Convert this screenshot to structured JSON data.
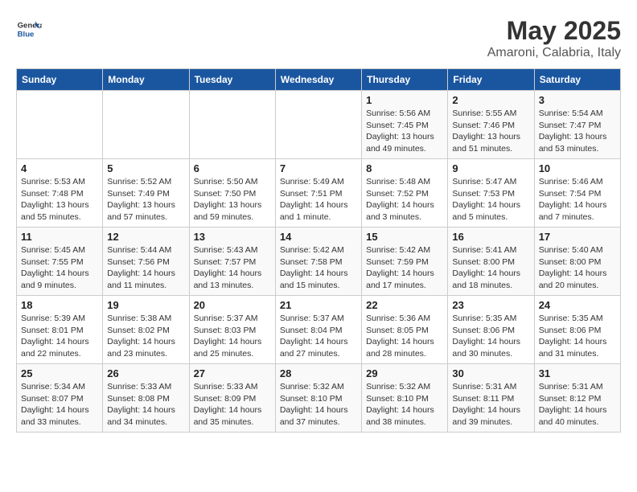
{
  "header": {
    "logo_general": "General",
    "logo_blue": "Blue",
    "title": "May 2025",
    "subtitle": "Amaroni, Calabria, Italy"
  },
  "calendar": {
    "days_of_week": [
      "Sunday",
      "Monday",
      "Tuesday",
      "Wednesday",
      "Thursday",
      "Friday",
      "Saturday"
    ],
    "weeks": [
      [
        {
          "day": "",
          "info": ""
        },
        {
          "day": "",
          "info": ""
        },
        {
          "day": "",
          "info": ""
        },
        {
          "day": "",
          "info": ""
        },
        {
          "day": "1",
          "info": "Sunrise: 5:56 AM\nSunset: 7:45 PM\nDaylight: 13 hours and 49 minutes."
        },
        {
          "day": "2",
          "info": "Sunrise: 5:55 AM\nSunset: 7:46 PM\nDaylight: 13 hours and 51 minutes."
        },
        {
          "day": "3",
          "info": "Sunrise: 5:54 AM\nSunset: 7:47 PM\nDaylight: 13 hours and 53 minutes."
        }
      ],
      [
        {
          "day": "4",
          "info": "Sunrise: 5:53 AM\nSunset: 7:48 PM\nDaylight: 13 hours and 55 minutes."
        },
        {
          "day": "5",
          "info": "Sunrise: 5:52 AM\nSunset: 7:49 PM\nDaylight: 13 hours and 57 minutes."
        },
        {
          "day": "6",
          "info": "Sunrise: 5:50 AM\nSunset: 7:50 PM\nDaylight: 13 hours and 59 minutes."
        },
        {
          "day": "7",
          "info": "Sunrise: 5:49 AM\nSunset: 7:51 PM\nDaylight: 14 hours and 1 minute."
        },
        {
          "day": "8",
          "info": "Sunrise: 5:48 AM\nSunset: 7:52 PM\nDaylight: 14 hours and 3 minutes."
        },
        {
          "day": "9",
          "info": "Sunrise: 5:47 AM\nSunset: 7:53 PM\nDaylight: 14 hours and 5 minutes."
        },
        {
          "day": "10",
          "info": "Sunrise: 5:46 AM\nSunset: 7:54 PM\nDaylight: 14 hours and 7 minutes."
        }
      ],
      [
        {
          "day": "11",
          "info": "Sunrise: 5:45 AM\nSunset: 7:55 PM\nDaylight: 14 hours and 9 minutes."
        },
        {
          "day": "12",
          "info": "Sunrise: 5:44 AM\nSunset: 7:56 PM\nDaylight: 14 hours and 11 minutes."
        },
        {
          "day": "13",
          "info": "Sunrise: 5:43 AM\nSunset: 7:57 PM\nDaylight: 14 hours and 13 minutes."
        },
        {
          "day": "14",
          "info": "Sunrise: 5:42 AM\nSunset: 7:58 PM\nDaylight: 14 hours and 15 minutes."
        },
        {
          "day": "15",
          "info": "Sunrise: 5:42 AM\nSunset: 7:59 PM\nDaylight: 14 hours and 17 minutes."
        },
        {
          "day": "16",
          "info": "Sunrise: 5:41 AM\nSunset: 8:00 PM\nDaylight: 14 hours and 18 minutes."
        },
        {
          "day": "17",
          "info": "Sunrise: 5:40 AM\nSunset: 8:00 PM\nDaylight: 14 hours and 20 minutes."
        }
      ],
      [
        {
          "day": "18",
          "info": "Sunrise: 5:39 AM\nSunset: 8:01 PM\nDaylight: 14 hours and 22 minutes."
        },
        {
          "day": "19",
          "info": "Sunrise: 5:38 AM\nSunset: 8:02 PM\nDaylight: 14 hours and 23 minutes."
        },
        {
          "day": "20",
          "info": "Sunrise: 5:37 AM\nSunset: 8:03 PM\nDaylight: 14 hours and 25 minutes."
        },
        {
          "day": "21",
          "info": "Sunrise: 5:37 AM\nSunset: 8:04 PM\nDaylight: 14 hours and 27 minutes."
        },
        {
          "day": "22",
          "info": "Sunrise: 5:36 AM\nSunset: 8:05 PM\nDaylight: 14 hours and 28 minutes."
        },
        {
          "day": "23",
          "info": "Sunrise: 5:35 AM\nSunset: 8:06 PM\nDaylight: 14 hours and 30 minutes."
        },
        {
          "day": "24",
          "info": "Sunrise: 5:35 AM\nSunset: 8:06 PM\nDaylight: 14 hours and 31 minutes."
        }
      ],
      [
        {
          "day": "25",
          "info": "Sunrise: 5:34 AM\nSunset: 8:07 PM\nDaylight: 14 hours and 33 minutes."
        },
        {
          "day": "26",
          "info": "Sunrise: 5:33 AM\nSunset: 8:08 PM\nDaylight: 14 hours and 34 minutes."
        },
        {
          "day": "27",
          "info": "Sunrise: 5:33 AM\nSunset: 8:09 PM\nDaylight: 14 hours and 35 minutes."
        },
        {
          "day": "28",
          "info": "Sunrise: 5:32 AM\nSunset: 8:10 PM\nDaylight: 14 hours and 37 minutes."
        },
        {
          "day": "29",
          "info": "Sunrise: 5:32 AM\nSunset: 8:10 PM\nDaylight: 14 hours and 38 minutes."
        },
        {
          "day": "30",
          "info": "Sunrise: 5:31 AM\nSunset: 8:11 PM\nDaylight: 14 hours and 39 minutes."
        },
        {
          "day": "31",
          "info": "Sunrise: 5:31 AM\nSunset: 8:12 PM\nDaylight: 14 hours and 40 minutes."
        }
      ]
    ]
  }
}
